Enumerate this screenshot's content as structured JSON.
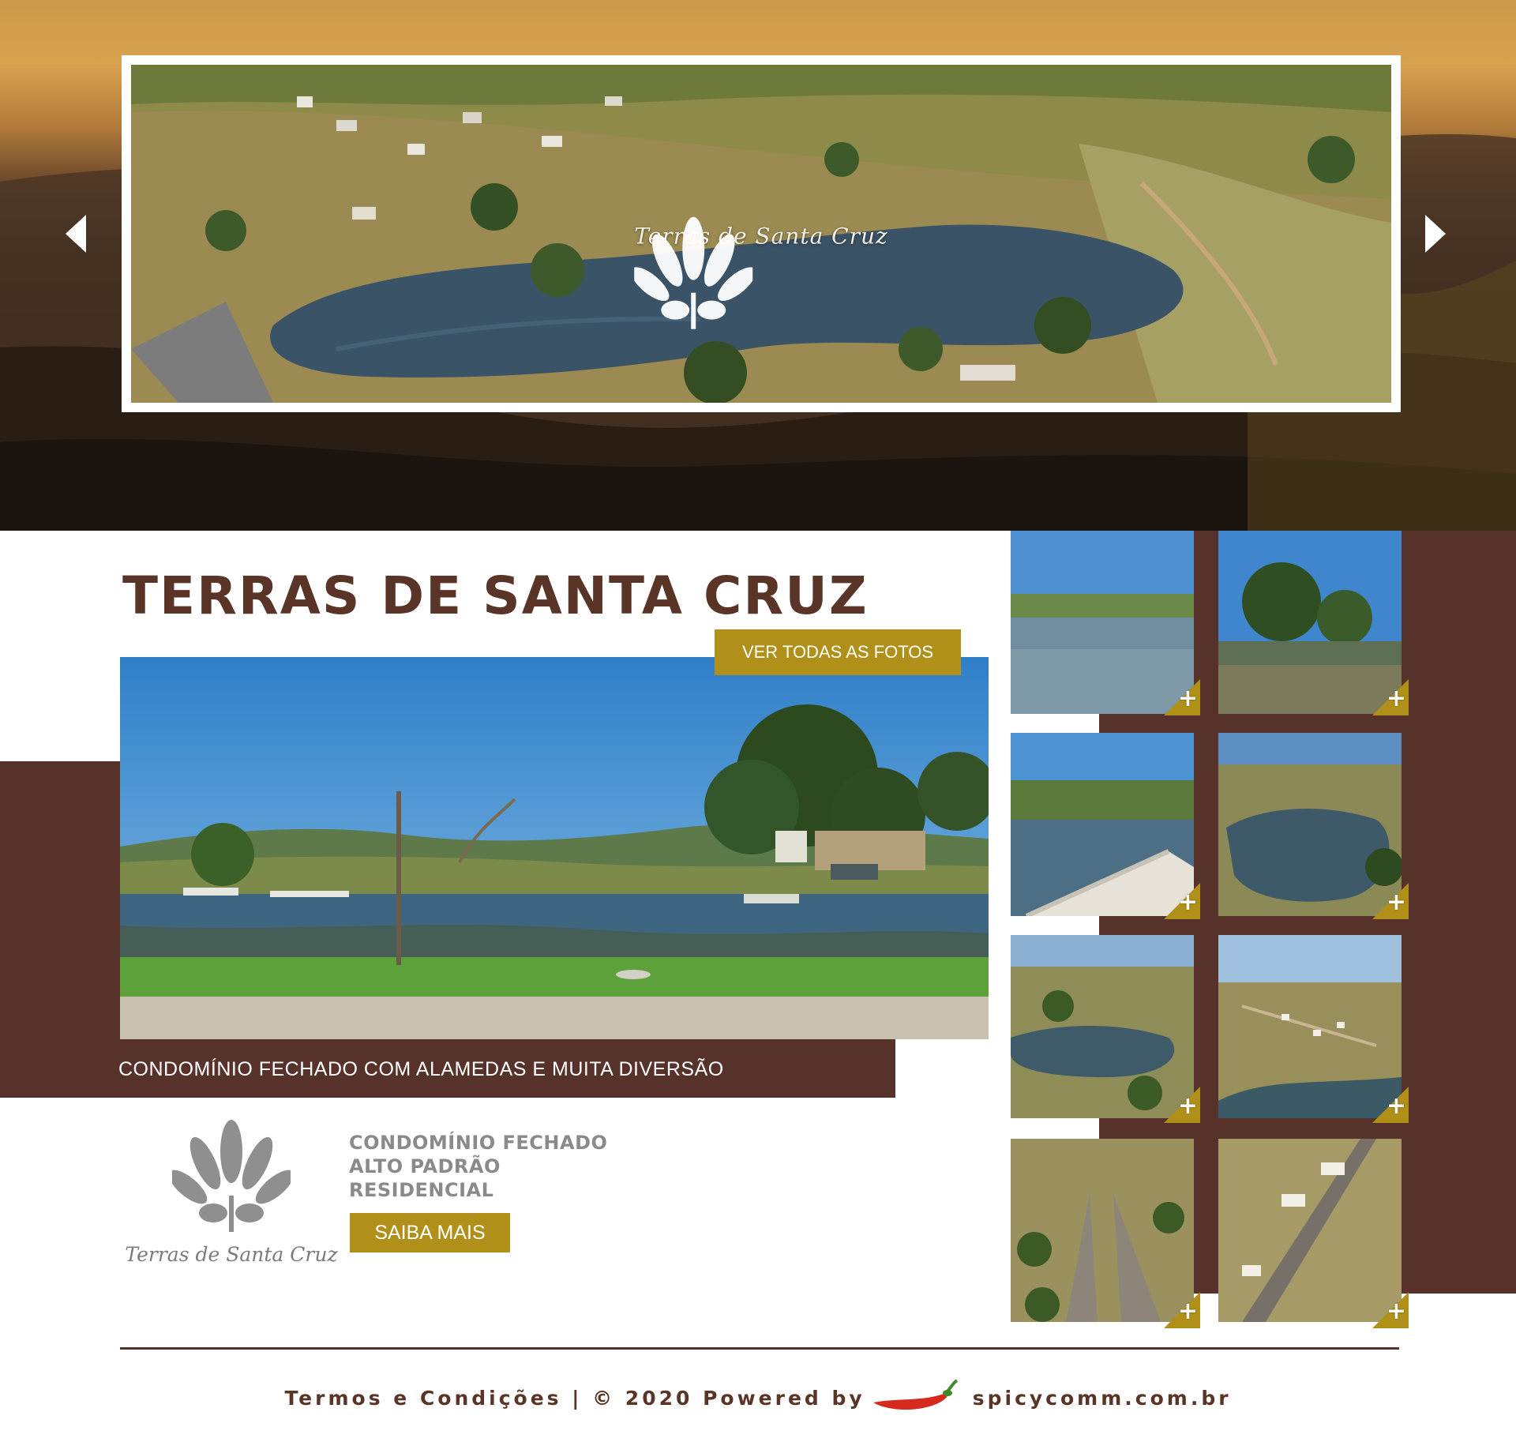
{
  "hero": {
    "logo_text": "Terras de Santa Cruz",
    "prev_label": "previous slide",
    "next_label": "next slide"
  },
  "main": {
    "title": "TERRAS DE SANTA CRUZ",
    "view_all_button": "VER TODAS AS FOTOS",
    "caption": "CONDOMÍNIO FECHADO COM ALAMEDAS E MUITA DIVERSÃO"
  },
  "info": {
    "logo_text": "Terras de Santa Cruz",
    "lines": [
      "CONDOMÍNIO FECHADO",
      "ALTO PADRÃO",
      "RESIDENCIAL"
    ],
    "button": "SAIBA MAIS"
  },
  "gallery": {
    "plus_symbol": "+",
    "thumbs": [
      {
        "scene": "lake"
      },
      {
        "scene": "island"
      },
      {
        "scene": "ramp"
      },
      {
        "scene": "aerial-lake"
      },
      {
        "scene": "aerial-hills"
      },
      {
        "scene": "aerial-lots"
      },
      {
        "scene": "road-fork"
      },
      {
        "scene": "road-houses"
      }
    ]
  },
  "footer": {
    "left_text": "Termos e Condições | © 2020 Powered by",
    "right_text": "spicycomm.com.br",
    "icon": "pepper-icon"
  },
  "colors": {
    "brown": "#56322b",
    "title_brown": "#5a3426",
    "gold": "#b09019",
    "gray_text": "#8a8a8a"
  }
}
